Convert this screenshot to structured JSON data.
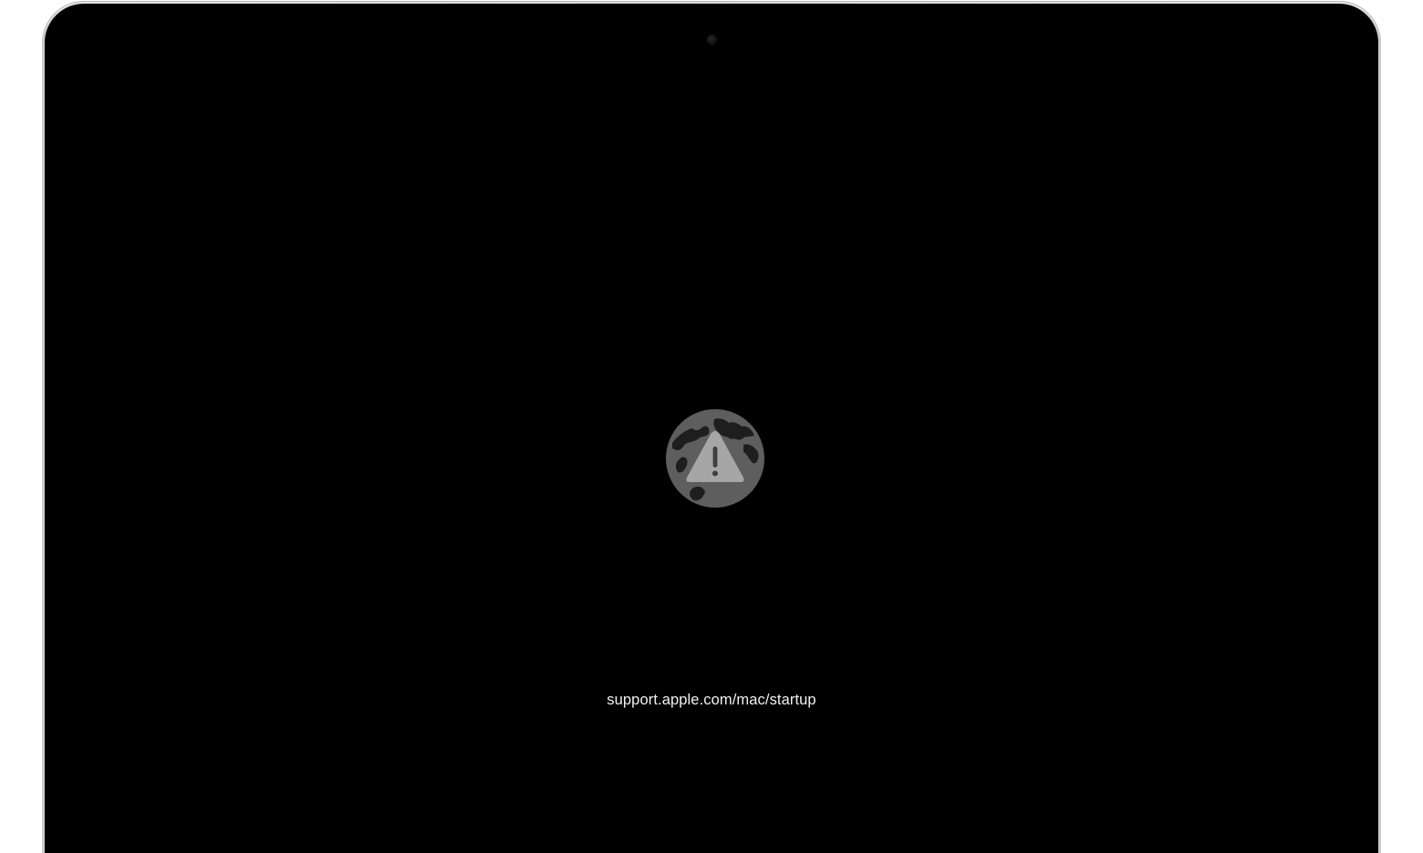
{
  "screen": {
    "support_url": "support.apple.com/mac/startup",
    "status_icon": "globe-warning-icon"
  },
  "colors": {
    "screen_background": "#000000",
    "text": "#f2f2f2",
    "icon_globe": "#5e5e5e",
    "icon_triangle": "#a6a6a6",
    "frame": "#d9d9dc"
  }
}
